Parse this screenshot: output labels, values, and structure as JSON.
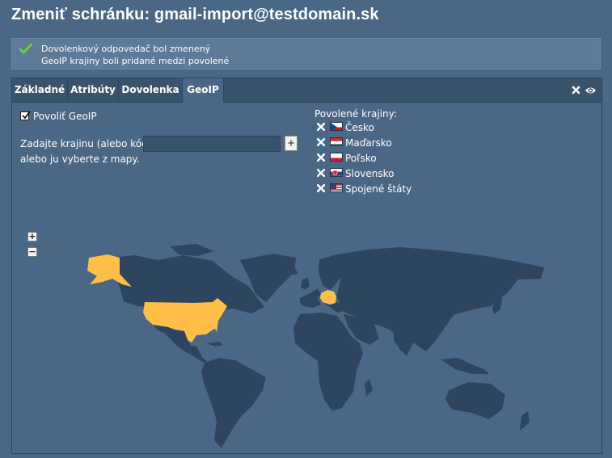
{
  "page": {
    "title": "Zmeniť schránku: gmail-import@testdomain.sk"
  },
  "notice": {
    "icon": "checkmark-icon",
    "lines": [
      "Dovolenkový odpovedač bol zmenený",
      "GeoIP krajiny boli pridané medzi povolené"
    ]
  },
  "tabs": [
    {
      "label": "Základné",
      "active": false
    },
    {
      "label": "Atribúty",
      "active": false
    },
    {
      "label": "Dovolenka",
      "active": false
    },
    {
      "label": "GeoIP",
      "active": true
    }
  ],
  "tab_tools": {
    "close_icon": "close-icon",
    "view_icon": "eye-icon"
  },
  "geoip": {
    "enable_label": "Povoliť GeoIP",
    "enabled": true,
    "country_prompt": "Zadajte krajinu (alebo kód):",
    "country_input_value": "",
    "add_button": "+",
    "map_hint": "alebo ju vyberte z mapy.",
    "allowed_title": "Povolené krajiny:",
    "allowed": [
      {
        "name": "Česko",
        "flag": "flag-cz-icon"
      },
      {
        "name": "Maďarsko",
        "flag": "flag-hu-icon"
      },
      {
        "name": "Poľsko",
        "flag": "flag-pl-icon"
      },
      {
        "name": "Slovensko",
        "flag": "flag-sk-icon"
      },
      {
        "name": "Spojené štáty",
        "flag": "flag-us-icon"
      }
    ],
    "zoom_in": "+",
    "zoom_out": "−"
  },
  "colors": {
    "background": "#4a6785",
    "land": "#2e4560",
    "selected_land": "#ffbf47",
    "tabbar": "#3a536d"
  }
}
